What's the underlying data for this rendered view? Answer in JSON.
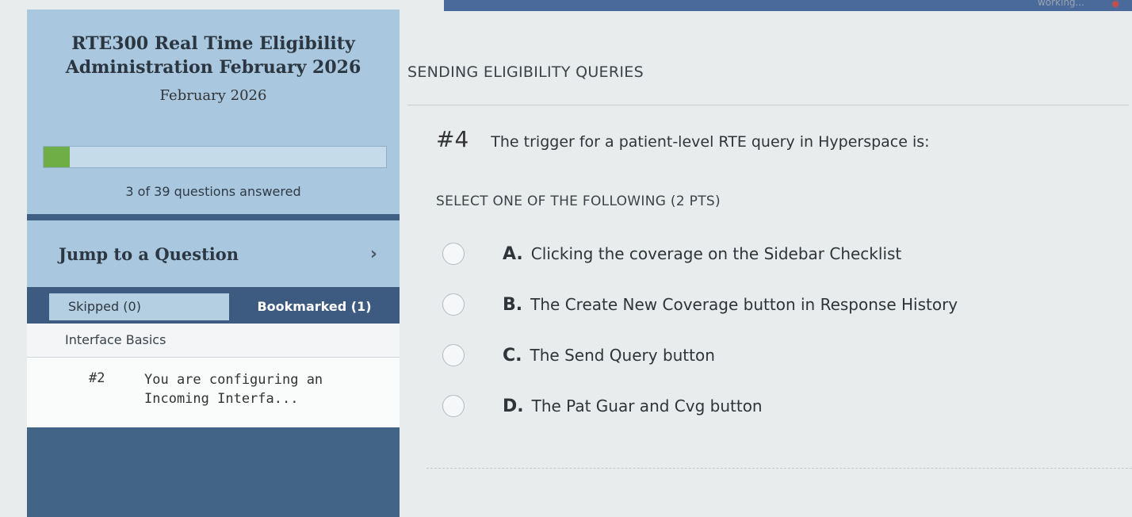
{
  "top": {
    "status_text": "working..."
  },
  "sidebar": {
    "course_title": "RTE300 Real Time Eligibility Administration February 2026",
    "course_date": "February 2026",
    "progress": {
      "answered": 3,
      "total": 39,
      "fraction": 0.077,
      "text": "3 of 39 questions answered"
    },
    "jump_label": "Jump to a Question",
    "tabs": [
      {
        "label": "Skipped (0)"
      },
      {
        "label": "Bookmarked (1)"
      }
    ],
    "section_label": "Interface Basics",
    "questions": [
      {
        "number": "#2",
        "text": "You are configuring an Incoming Interfa..."
      }
    ]
  },
  "main": {
    "section_heading": "SENDING ELIGIBILITY QUERIES",
    "question_number": "#4",
    "question_text": "The trigger for a patient-level RTE query in Hyperspace is:",
    "instruction": "SELECT ONE OF THE FOLLOWING (2 PTS)",
    "options": [
      {
        "letter": "A.",
        "text": "Clicking the coverage on the Sidebar Checklist"
      },
      {
        "letter": "B.",
        "text": "The Create New Coverage button in Response History"
      },
      {
        "letter": "C.",
        "text": "The Send Query button"
      },
      {
        "letter": "D.",
        "text": "The Pat Guar and Cvg button"
      }
    ]
  },
  "colors": {
    "sidebar_dark": "#426487",
    "sidebar_light": "#a9c7df",
    "progress_fill": "#6fae47",
    "top_bar": "#4a6a9c"
  }
}
